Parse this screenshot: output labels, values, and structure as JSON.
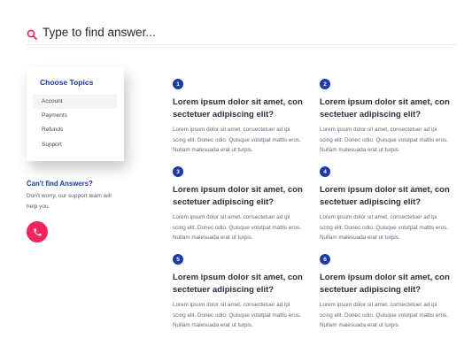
{
  "search": {
    "placeholder": "Type to find answer..."
  },
  "topics": {
    "title": "Choose Topics",
    "items": [
      "Account",
      "Payments",
      "Refunds",
      "Support"
    ],
    "active_index": 0
  },
  "help": {
    "title": "Can't find Answers?",
    "text": "Don't worry, our support team will help you."
  },
  "faqs": [
    {
      "number": "1",
      "question": "Lorem ipsum dolor sit amet, con sectetuer adipiscing elit?",
      "answer": "Lorem ipsum dolor sit amet, consectetuer ad ipi scing elit. Donec odio. Quisque volutpat mattis eros. Nullam malesuada erat ut turpis."
    },
    {
      "number": "2",
      "question": "Lorem ipsum dolor sit amet, con sectetuer adipiscing elit?",
      "answer": "Lorem ipsum dolor sit amet, consectetuer ad ipi scing elit. Donec odio. Quisque volutpat mattis eros. Nullam malesuada erat ut turpis."
    },
    {
      "number": "3",
      "question": "Lorem ipsum dolor sit amet, con sectetuer adipiscing elit?",
      "answer": "Lorem ipsum dolor sit amet, consectetuer ad ipi scing elit. Donec odio. Quisque volutpat mattis eros. Nullam malesuada erat ut turpis."
    },
    {
      "number": "4",
      "question": "Lorem ipsum dolor sit amet, con sectetuer adipiscing elit?",
      "answer": "Lorem ipsum dolor sit amet, consectetuer ad ipi scing elit. Donec odio. Quisque volutpat mattis eros. Nullam malesuada erat ut turpis."
    },
    {
      "number": "5",
      "question": "Lorem ipsum dolor sit amet, con sectetuer adipiscing elit?",
      "answer": "Lorem ipsum dolor sit amet, consectetuer ad ipi scing elit. Donec odio. Quisque volutpat mattis eros. Nullam malesuada erat ut turpis."
    },
    {
      "number": "6",
      "question": "Lorem ipsum dolor sit amet, con sectetuer adipiscing elit?",
      "answer": "Lorem ipsum dolor sit amet, consectetuer ad ipi scing elit. Donec odio. Quisque volutpat mattis eros. Nullam malesuada erat ut turpis."
    }
  ],
  "colors": {
    "accent": "#1e3aa5",
    "call_button": "#f3245d",
    "search_icon": "#e8264f"
  },
  "icons": {
    "search": "search-icon",
    "call": "phone-icon"
  }
}
